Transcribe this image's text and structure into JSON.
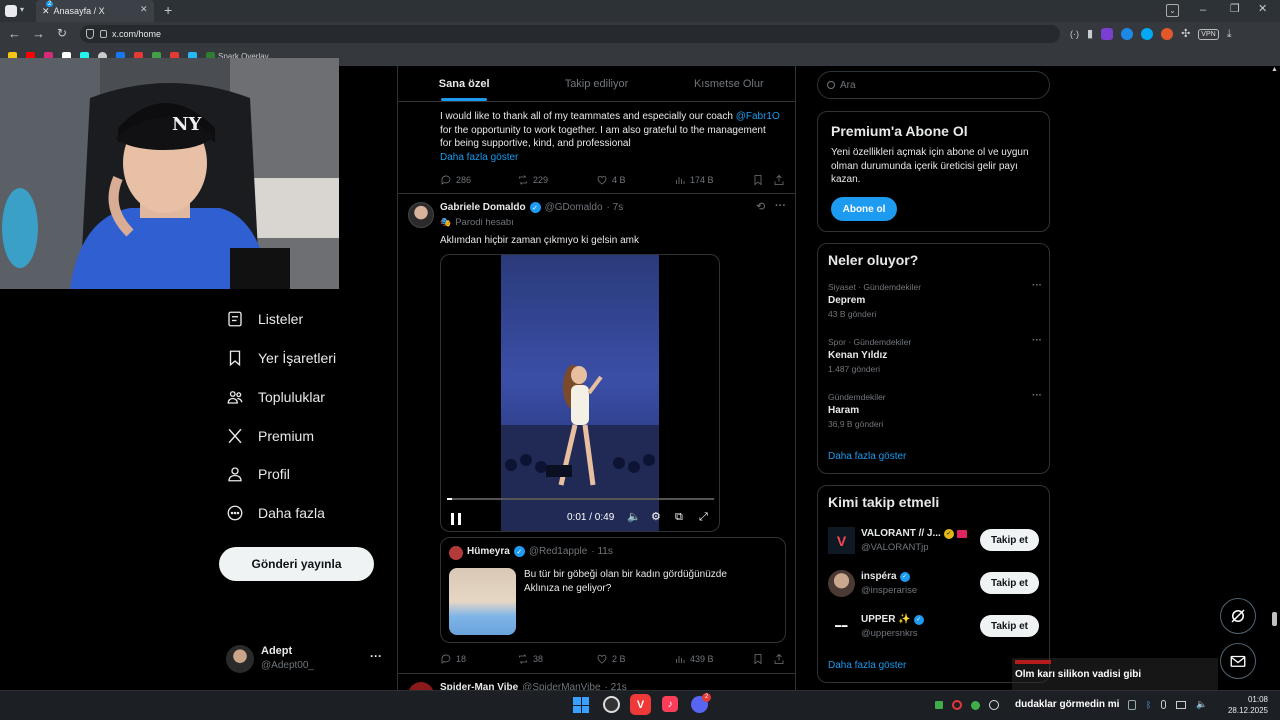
{
  "browser": {
    "tab_title": "Anasayfa / X",
    "tab_badge": "2",
    "url": "x.com/home",
    "bookmark_label": "Spark Overlay",
    "vpn_label": "VPN"
  },
  "nav": {
    "items": [
      {
        "label": "Listeler",
        "icon": "list-icon"
      },
      {
        "label": "Yer İşaretleri",
        "icon": "bookmark-icon"
      },
      {
        "label": "Topluluklar",
        "icon": "communities-icon"
      },
      {
        "label": "Premium",
        "icon": "x-logo-icon"
      },
      {
        "label": "Profil",
        "icon": "profile-icon"
      },
      {
        "label": "Daha fazla",
        "icon": "more-circle-icon"
      }
    ],
    "post_button": "Gönderi yayınla",
    "account": {
      "name": "Adept",
      "handle": "@Adept00_",
      "more": "···"
    }
  },
  "feed": {
    "tabs": [
      {
        "label": "Sana özel",
        "active": true
      },
      {
        "label": "Takip ediliyor",
        "active": false
      },
      {
        "label": "Kısmetse Olur",
        "active": false
      }
    ],
    "tweet1": {
      "text_before_mention": "I would like to thank all of my teammates and especially our coach ",
      "mention": "@Fabr1O",
      "text_line2": "for the opportunity to work together. I am also grateful to the management",
      "text_line3": "for being supportive, kind, and professional",
      "show_more": "Daha fazla göster",
      "replies": "286",
      "retweets": "229",
      "likes": "4 B",
      "views": "174 B"
    },
    "tweet2": {
      "name": "Gabriele Domaldo",
      "handle": "@GDomaldo",
      "time": "· 7s",
      "label": "Parodi hesabı",
      "text": "Aklımdan hiçbir zaman çıkmıyo ki gelsin amk",
      "video_time": "0:01 / 0:49",
      "video_progress": 0.02,
      "quote": {
        "name": "Hümeyra",
        "handle": "@Red1apple",
        "time": "· 11s",
        "line1": "Bu tür bir göbeği olan bir kadın gördüğünüzde",
        "line2": "Aklınıza ne geliyor?"
      },
      "replies": "18",
      "retweets": "38",
      "likes": "2 B",
      "views": "439 B"
    },
    "tweet3": {
      "name": "Spider-Man Vibe",
      "handle": "@SpiderManVibe",
      "time": "· 21s"
    }
  },
  "right": {
    "search_placeholder": "Ara",
    "premium": {
      "title": "Premium'a Abone Ol",
      "line1": "Yeni özellikleri açmak için abone ol ve uygun",
      "line2": "olman durumunda içerik üreticisi gelir payı",
      "line3": "kazan.",
      "button": "Abone ol"
    },
    "trends": {
      "title": "Neler oluyor?",
      "items": [
        {
          "category": "Siyaset · Gündemdekiler",
          "name": "Deprem",
          "count": "43 B gönderi"
        },
        {
          "category": "Spor · Gündemdekiler",
          "name": "Kenan Yıldız",
          "count": "1.487 gönderi"
        },
        {
          "category": "Gündemdekiler",
          "name": "Haram",
          "count": "36,9 B gönderi"
        }
      ],
      "show_more": "Daha fazla göster"
    },
    "who_to_follow": {
      "title": "Kimi takip etmeli",
      "items": [
        {
          "name": "VALORANT // J...",
          "handle": "@VALORANTjp",
          "button": "Takip et"
        },
        {
          "name": "inspéra",
          "handle": "@insperarise",
          "button": "Takip et"
        },
        {
          "name": "UPPER ✨",
          "handle": "@uppersnkrs",
          "button": "Takip et"
        }
      ],
      "show_more": "Daha fazla göster"
    }
  },
  "overlay": {
    "chat_line1": "Olm karı silikon vadisi gibi",
    "chat_line2": "dudaklar görmedin mi"
  },
  "taskbar": {
    "time": "01:08",
    "date": "28.12.2025",
    "discord_badge": "2"
  },
  "colors": {
    "accent": "#1d9bf0",
    "background": "#000000",
    "border": "#2f3336",
    "muted": "#71767b"
  }
}
